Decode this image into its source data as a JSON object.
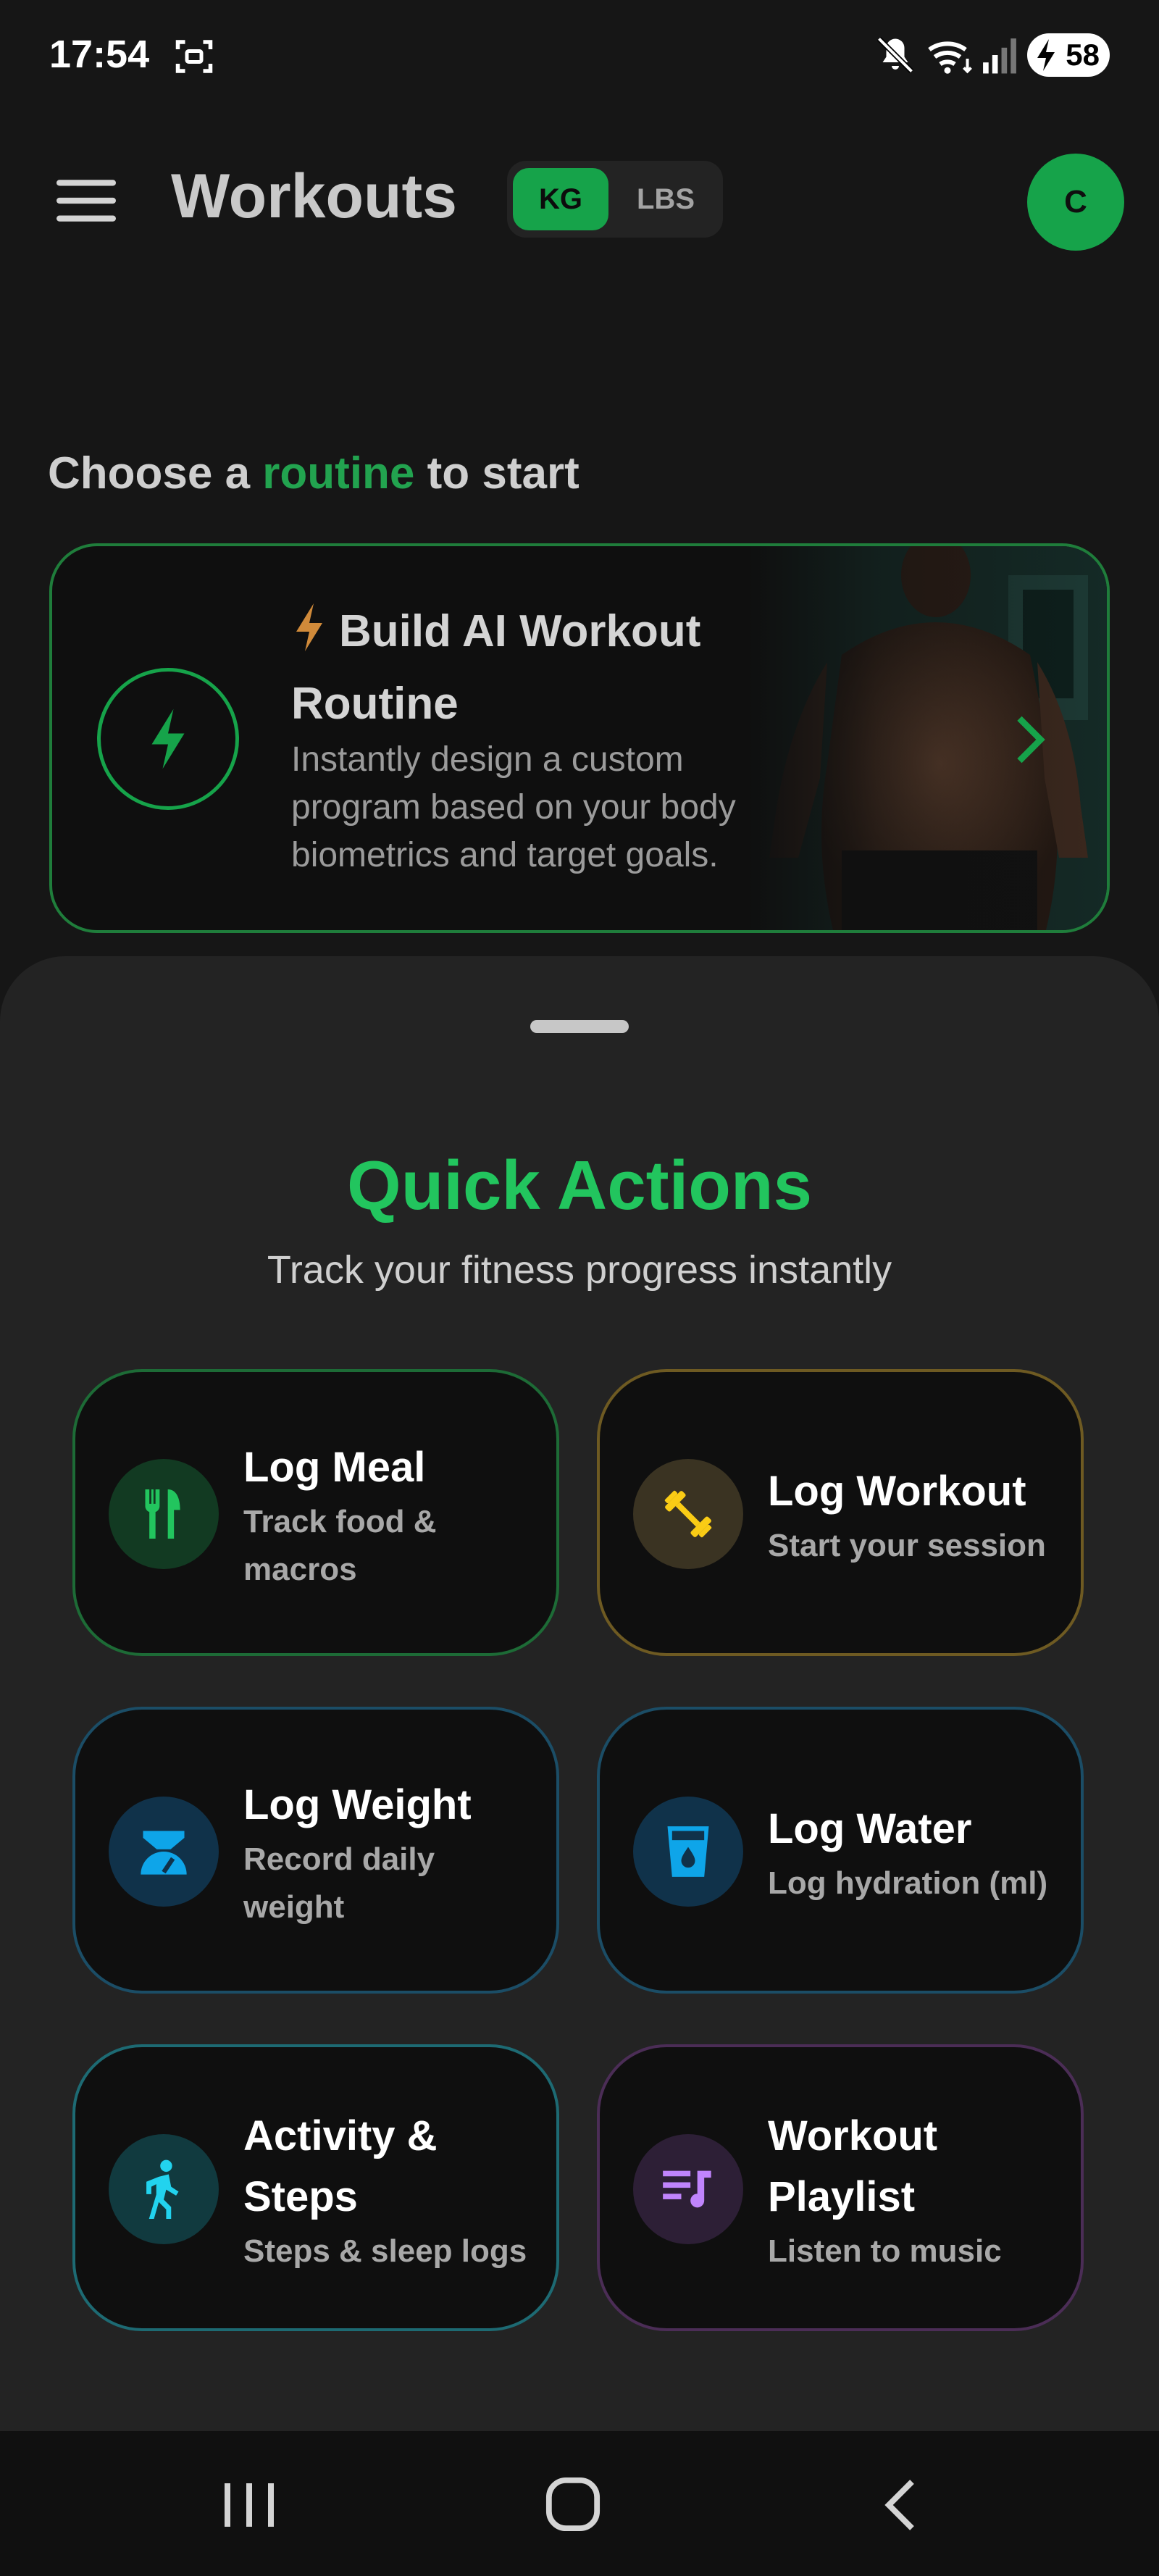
{
  "status_bar": {
    "time": "17:54",
    "battery": "58",
    "icons": [
      "screenshot-icon",
      "mute-icon",
      "wifi-icon",
      "signal-icon",
      "battery-charging-icon"
    ]
  },
  "header": {
    "title": "Workouts",
    "unit_toggle": {
      "options": [
        "KG",
        "LBS"
      ],
      "selected": "KG"
    },
    "avatar_initial": "C"
  },
  "routine_section": {
    "heading_pre": "Choose a ",
    "heading_highlight": "routine",
    "heading_post": " to start",
    "ai_card": {
      "title": "Build AI Workout Routine",
      "description": "Instantly design a custom program based on your body biometrics and target goals.",
      "icon": "bolt-icon"
    }
  },
  "quick_actions": {
    "title": "Quick Actions",
    "subtitle": "Track your fitness progress instantly",
    "items": [
      {
        "title": "Log Meal",
        "subtitle": "Track food & macros",
        "icon": "fork-knife-icon",
        "accent": "#22c55e"
      },
      {
        "title": "Log Workout",
        "subtitle": "Start your session",
        "icon": "dumbbell-icon",
        "accent": "#facc15"
      },
      {
        "title": "Log Weight",
        "subtitle": "Record daily weight",
        "icon": "scale-icon",
        "accent": "#0ea5e9"
      },
      {
        "title": "Log Water",
        "subtitle": "Log hydration (ml)",
        "icon": "water-cup-icon",
        "accent": "#0ea5e9"
      },
      {
        "title": "Activity & Steps",
        "subtitle": "Steps & sleep logs",
        "icon": "walking-icon",
        "accent": "#22d3ee"
      },
      {
        "title": "Workout Playlist",
        "subtitle": "Listen to music",
        "icon": "playlist-icon",
        "accent": "#c084fc"
      }
    ]
  },
  "colors": {
    "brand_green": "#16a34a",
    "background": "#161616",
    "sheet": "#232323"
  },
  "nav_bar": {
    "icons": [
      "recents-icon",
      "home-icon",
      "back-icon"
    ]
  }
}
